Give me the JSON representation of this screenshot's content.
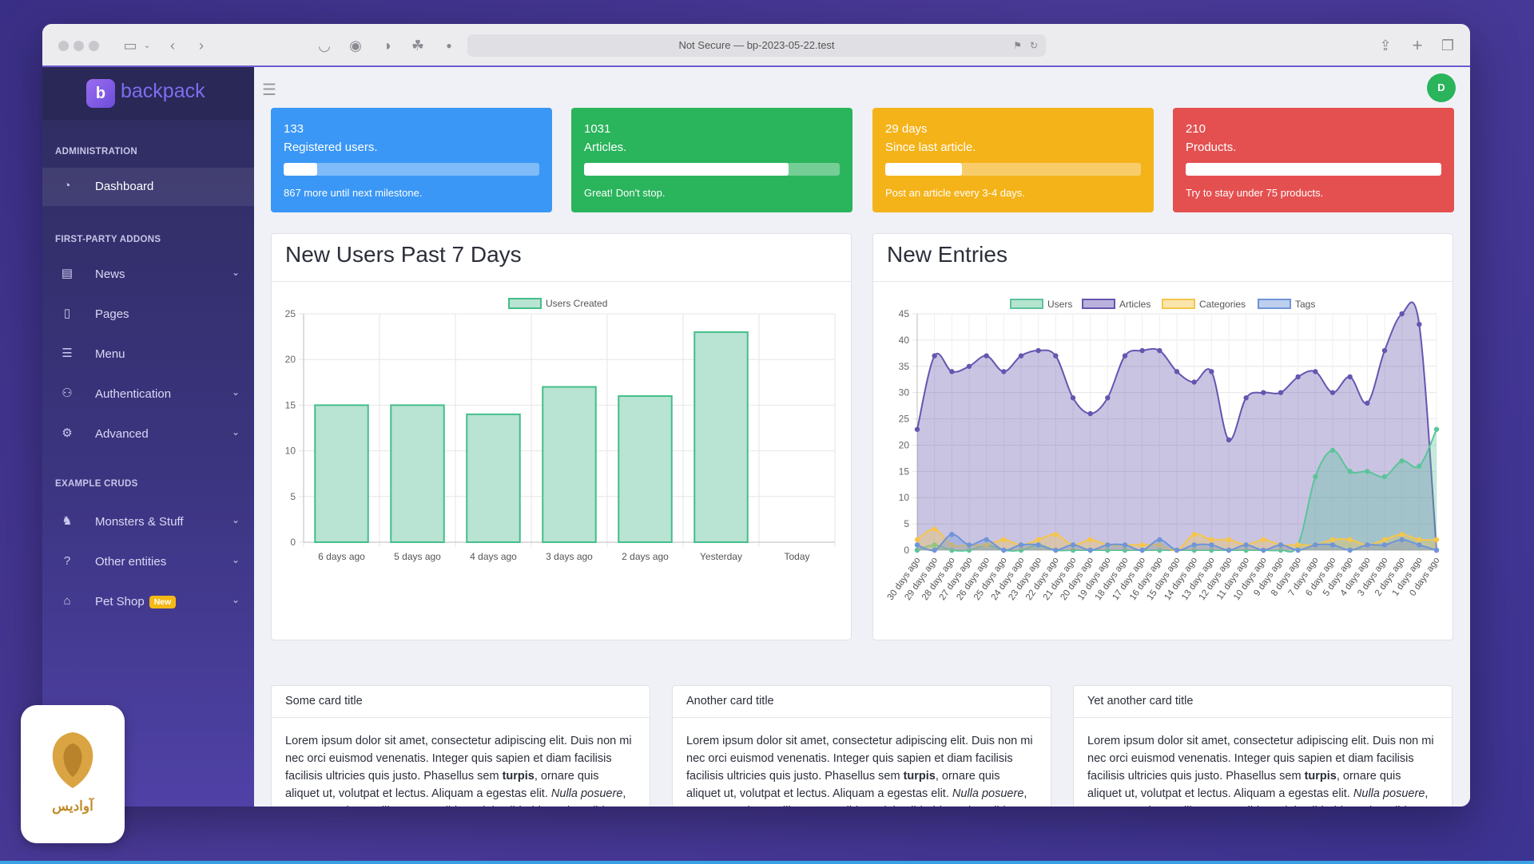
{
  "browser": {
    "address": "Not Secure — bp-2023-05-22.test"
  },
  "brand": {
    "logo_letter": "b",
    "name": "backpack"
  },
  "sidebar": {
    "sections": [
      {
        "title": "ADMINISTRATION"
      },
      {
        "title": "FIRST-PARTY ADDONS"
      },
      {
        "title": "EXAMPLE CRUDS"
      }
    ],
    "items": [
      {
        "label": "Dashboard",
        "icon": "gauge-icon"
      },
      {
        "label": "News",
        "icon": "newspaper-icon"
      },
      {
        "label": "Pages",
        "icon": "file-icon"
      },
      {
        "label": "Menu",
        "icon": "list-icon"
      },
      {
        "label": "Authentication",
        "icon": "users-icon"
      },
      {
        "label": "Advanced",
        "icon": "cogs-icon"
      },
      {
        "label": "Monsters & Stuff",
        "icon": "monster-icon"
      },
      {
        "label": "Other entities",
        "icon": "question-icon"
      },
      {
        "label": "Pet Shop",
        "icon": "pet-shop-icon",
        "badge": "New"
      }
    ]
  },
  "header": {
    "avatar_initial": "D"
  },
  "stats": [
    {
      "value": "133",
      "label": "Registered users.",
      "progress": 0.13,
      "description": "867 more until next milestone.",
      "color": "#3a97f5"
    },
    {
      "value": "1031",
      "label": "Articles.",
      "progress": 0.8,
      "description": "Great! Don't stop.",
      "color": "#2ab45c"
    },
    {
      "value": "29 days",
      "label": "Since last article.",
      "progress": 0.3,
      "description": "Post an article every 3-4 days.",
      "color": "#f5b31a"
    },
    {
      "value": "210",
      "label": "Products.",
      "progress": 1.0,
      "description": "Try to stay under 75 products.",
      "color": "#e45050"
    }
  ],
  "panels": {
    "users_title": "New Users Past 7 Days",
    "entries_title": "New Entries"
  },
  "cards": [
    {
      "title": "Some card title"
    },
    {
      "title": "Another card title"
    },
    {
      "title": "Yet another card title"
    }
  ],
  "lorem": {
    "p1": "Lorem ipsum dolor sit amet, consectetur adipiscing elit. Duis non mi nec orci euismod venenatis. Integer quis sapien et diam facilisis facilisis ultricies quis justo. Phasellus sem ",
    "bold": "turpis",
    "p2": ", ornare quis aliquet ut, volutpat et lectus. Aliquam a egestas elit. ",
    "italic": "Nulla posuere",
    "p3": ", sem et porttitor mollis, massa nibh sagittis nibh, id porttitor nibh turpis sed arcu."
  },
  "watermark": {
    "text": "آوادیس"
  },
  "chart_data": [
    {
      "type": "bar",
      "categories": [
        "6 days ago",
        "5 days ago",
        "4 days ago",
        "3 days ago",
        "2 days ago",
        "Yesterday",
        "Today"
      ],
      "series": [
        {
          "name": "Users Created",
          "values": [
            15,
            15,
            14,
            17,
            16,
            23,
            0
          ]
        }
      ],
      "ylim": [
        0,
        25
      ],
      "yticks": [
        0,
        5,
        10,
        15,
        20,
        25
      ],
      "colors": {
        "fill": "#b9e3d3",
        "stroke": "#44be8a"
      },
      "legend": "top"
    },
    {
      "type": "area",
      "categories": [
        "30 days ago",
        "29 days ago",
        "28 days ago",
        "27 days ago",
        "26 days ago",
        "25 days ago",
        "24 days ago",
        "23 days ago",
        "22 days ago",
        "21 days ago",
        "20 days ago",
        "19 days ago",
        "18 days ago",
        "17 days ago",
        "16 days ago",
        "15 days ago",
        "14 days ago",
        "13 days ago",
        "12 days ago",
        "11 days ago",
        "10 days ago",
        "9 days ago",
        "8 days ago",
        "7 days ago",
        "6 days ago",
        "5 days ago",
        "4 days ago",
        "3 days ago",
        "2 days ago",
        "1 days ago",
        "0 days ago"
      ],
      "series": [
        {
          "name": "Users",
          "color": "#5cc49a",
          "values": [
            0,
            1,
            0,
            0,
            1,
            0,
            0,
            1,
            0,
            0,
            0,
            0,
            0,
            0,
            0,
            0,
            0,
            0,
            0,
            0,
            0,
            0,
            1,
            14,
            19,
            15,
            15,
            14,
            17,
            16,
            23
          ]
        },
        {
          "name": "Articles",
          "color": "#6655b0",
          "values": [
            23,
            37,
            34,
            35,
            37,
            34,
            37,
            38,
            37,
            29,
            26,
            29,
            37,
            38,
            38,
            34,
            32,
            34,
            21,
            29,
            30,
            30,
            33,
            34,
            30,
            33,
            28,
            38,
            45,
            43,
            0
          ]
        },
        {
          "name": "Categories",
          "color": "#f5c64a",
          "values": [
            2,
            4,
            1,
            1,
            1,
            2,
            1,
            2,
            3,
            1,
            2,
            1,
            1,
            1,
            1,
            0,
            3,
            2,
            2,
            1,
            2,
            1,
            1,
            1,
            2,
            2,
            1,
            2,
            3,
            2,
            2
          ]
        },
        {
          "name": "Tags",
          "color": "#6f95d8",
          "values": [
            1,
            0,
            3,
            1,
            2,
            0,
            1,
            1,
            0,
            1,
            0,
            1,
            1,
            0,
            2,
            0,
            1,
            1,
            0,
            1,
            0,
            1,
            0,
            1,
            1,
            0,
            1,
            1,
            2,
            1,
            0
          ]
        }
      ],
      "ylim": [
        0,
        45
      ],
      "yticks": [
        0,
        5,
        10,
        15,
        20,
        25,
        30,
        35,
        40,
        45
      ],
      "legend": "top"
    }
  ]
}
